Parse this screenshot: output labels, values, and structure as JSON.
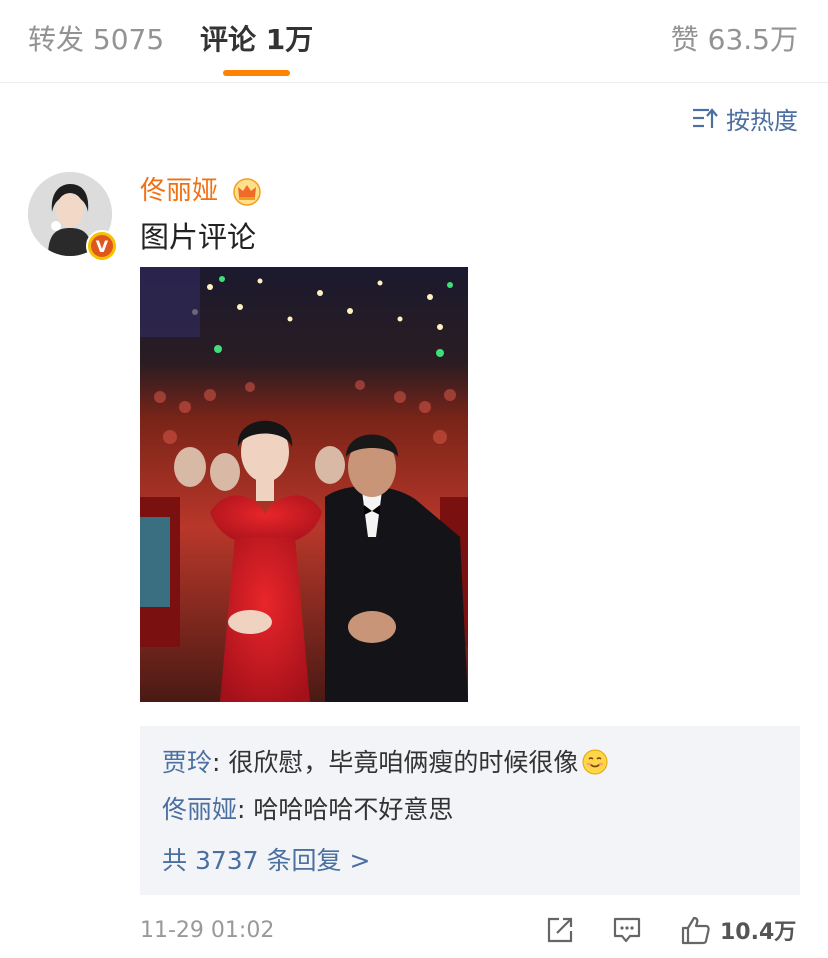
{
  "tabs": {
    "repost_label": "转发 5075",
    "comment_label": "评论 1万",
    "like_label": "赞 63.5万"
  },
  "sort": {
    "label": "按热度"
  },
  "comment": {
    "username": "佟丽娅",
    "text": "图片评论",
    "timestamp": "11-29 01:02",
    "like_count": "10.4万"
  },
  "replies": {
    "items": [
      {
        "name": "贾玲",
        "separator": ": ",
        "text": "很欣慰，毕竟咱俩瘦的时候很像"
      },
      {
        "name": "佟丽娅",
        "separator": ": ",
        "text": "哈哈哈哈不好意思"
      }
    ],
    "more_label": "共 3737 条回复 >"
  },
  "colors": {
    "accent_orange": "#ff8200",
    "username_orange": "#f07013",
    "link_blue": "#4a6fa0",
    "reply_bg": "#f2f4f7"
  },
  "icons": {
    "sort": "sort-icon",
    "crown": "crown-icon",
    "verified": "verified-badge-icon",
    "smile": "smile-emoji-icon",
    "repost": "share-icon",
    "comment": "comment-icon",
    "like": "thumbs-up-icon"
  }
}
